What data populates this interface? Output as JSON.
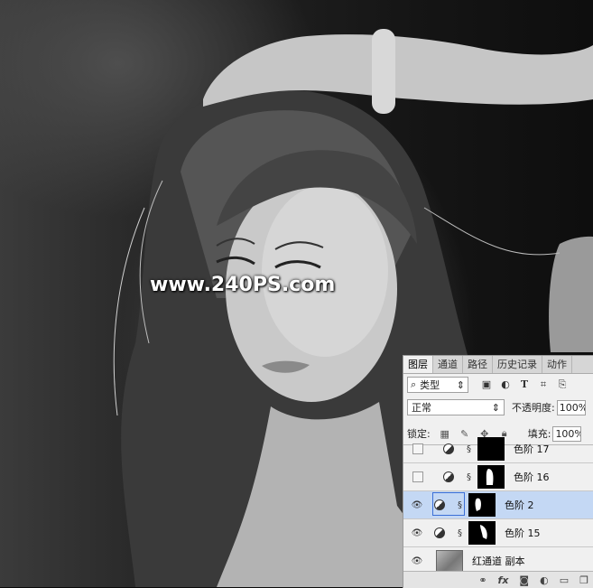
{
  "watermark": "www.240PS.com",
  "panel": {
    "tabs": [
      "图层",
      "通道",
      "路径",
      "历史记录",
      "动作"
    ],
    "active_tab": "图层",
    "filter": {
      "icon": "search-icon",
      "label": "类型"
    },
    "blend_mode": "正常",
    "opacity_label": "不透明度:",
    "opacity_value": "100%",
    "lock_label": "锁定:",
    "fill_label": "填充:",
    "fill_value": "100%",
    "layers": [
      {
        "name": "色阶 17",
        "visible": false,
        "selected": false,
        "kind": "levels"
      },
      {
        "name": "色阶 16",
        "visible": false,
        "selected": false,
        "kind": "levels"
      },
      {
        "name": "色阶 2",
        "visible": true,
        "selected": true,
        "kind": "levels"
      },
      {
        "name": "色阶 15",
        "visible": true,
        "selected": false,
        "kind": "levels"
      },
      {
        "name": "红通道 副本",
        "visible": true,
        "selected": false,
        "kind": "pixel"
      }
    ],
    "bottom_icons": [
      "link-icon",
      "fx-icon",
      "mask-icon",
      "adjustment-icon",
      "group-folder-icon",
      "new-layer-icon"
    ]
  }
}
